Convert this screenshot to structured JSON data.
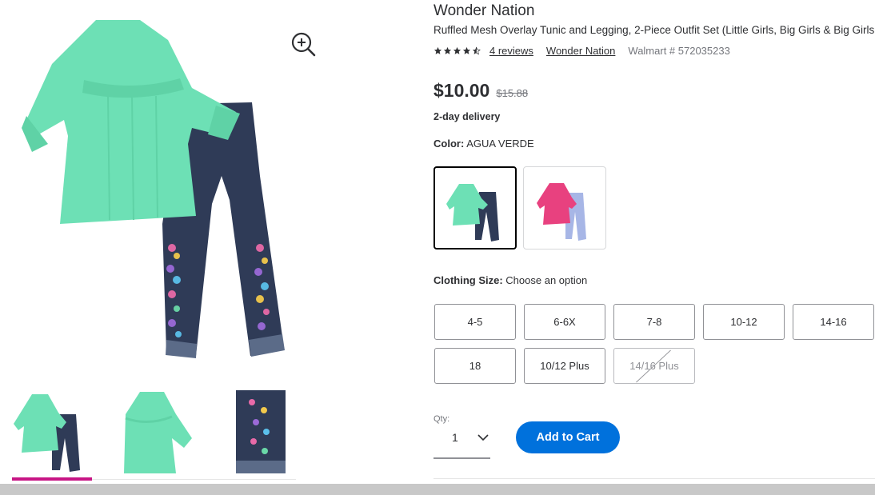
{
  "product": {
    "brand": "Wonder Nation",
    "name": "Ruffled Mesh Overlay Tunic and Legging, 2-Piece Outfit Set (Little Girls, Big Girls & Big Girls Plus)",
    "rating": 4.5,
    "reviews_label": "4 reviews",
    "brand_link": "Wonder Nation",
    "walmart_number": "Walmart # 572035233"
  },
  "pricing": {
    "price": "$10.00",
    "was_price": "$15.88",
    "delivery": "2-day delivery"
  },
  "color": {
    "label": "Color:",
    "selected": "AGUA VERDE",
    "swatches": [
      "agua-verde",
      "pink"
    ]
  },
  "size": {
    "label": "Clothing Size:",
    "prompt": "Choose an option",
    "options": [
      {
        "label": "4-5",
        "available": true
      },
      {
        "label": "6-6X",
        "available": true
      },
      {
        "label": "7-8",
        "available": true
      },
      {
        "label": "10-12",
        "available": true
      },
      {
        "label": "14-16",
        "available": true
      },
      {
        "label": "18",
        "available": true
      },
      {
        "label": "10/12 Plus",
        "available": true
      },
      {
        "label": "14/16 Plus",
        "available": false
      }
    ]
  },
  "quantity": {
    "label": "Qty:",
    "value": "1"
  },
  "cart": {
    "add_label": "Add to Cart"
  },
  "icons": {
    "zoom": "zoom-in-icon",
    "chevron": "chevron-down-icon",
    "star": "star-icon"
  },
  "colors": {
    "accent_blue": "#0071dc",
    "thumb_indicator": "#c71585",
    "tunic_mint": "#6de0b5",
    "legging_navy": "#2f3b57"
  }
}
